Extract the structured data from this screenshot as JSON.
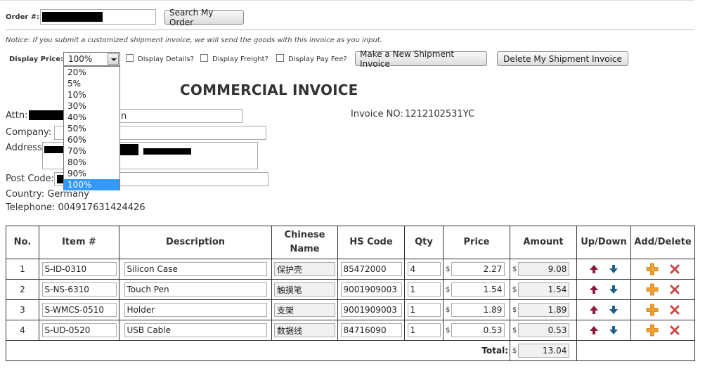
{
  "order": {
    "label": "Order #:",
    "button": "Search My Order"
  },
  "notice": "Notice: If you submit a customized shipment invoice, we will send the goods with this invoice as you input.",
  "display_price": {
    "label": "Display Price:",
    "selected": "100%",
    "options": [
      "20%",
      "5%",
      "10%",
      "30%",
      "40%",
      "50%",
      "60%",
      "70%",
      "80%",
      "90%",
      "100%"
    ]
  },
  "checkboxes": [
    "Display Details?",
    "Display Freight?",
    "Display Pay Fee?"
  ],
  "buttons": {
    "new_invoice": "Make a New Shipment Invoice",
    "delete_invoice": "Delete My Shipment Invoice"
  },
  "invoice": {
    "title": "COMMERCIAL INVOICE",
    "invoice_no_label": "Invoice NO:",
    "invoice_no": "1212102531YC"
  },
  "address": {
    "attn_label": "Attn:",
    "attn_partial": "n",
    "company_label": "Company:",
    "address_label": "Address:",
    "postcode_label": "Post Code:",
    "country": "Country: Germany",
    "telephone": "Telephone: 004917631424426"
  },
  "table": {
    "headers": [
      "No.",
      "Item #",
      "Description",
      "Chinese Name",
      "HS Code",
      "Qty",
      "Price",
      "Amount",
      "Up/Down",
      "Add/Delete"
    ],
    "currency": "$",
    "rows": [
      {
        "no": "1",
        "item": "S-ID-0310",
        "desc": "Silicon Case",
        "cn": "保护壳",
        "hs": "85472000",
        "qty": "4",
        "price": "2.27",
        "amount": "9.08"
      },
      {
        "no": "2",
        "item": "S-NS-6310",
        "desc": "Touch Pen",
        "cn": "触摸笔",
        "hs": "9001909003",
        "qty": "1",
        "price": "1.54",
        "amount": "1.54"
      },
      {
        "no": "3",
        "item": "S-WMCS-0510",
        "desc": "Holder",
        "cn": "支架",
        "hs": "9001909003",
        "qty": "1",
        "price": "1.89",
        "amount": "1.89"
      },
      {
        "no": "4",
        "item": "S-UD-0520",
        "desc": "USB Cable",
        "cn": "数据线",
        "hs": "84716090",
        "qty": "1",
        "price": "0.53",
        "amount": "0.53"
      }
    ],
    "total_label": "Total:",
    "total": "13.04"
  },
  "colors": {
    "up_arrow": "#8b1a3a",
    "down_arrow": "#1f5f8b",
    "add": "#f0a030",
    "delete": "#c84848",
    "selected_option": "#3399ff"
  }
}
